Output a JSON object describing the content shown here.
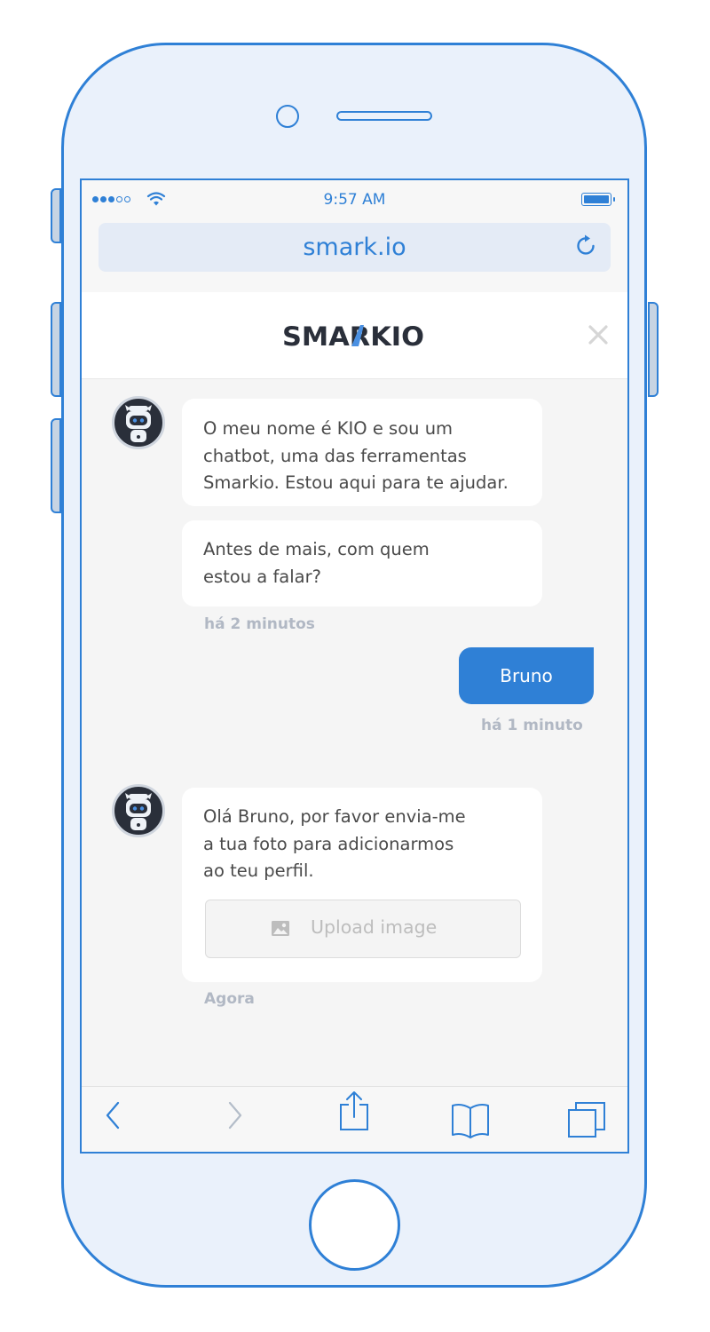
{
  "status_bar": {
    "time": "9:57 AM"
  },
  "browser": {
    "url": "smark.io"
  },
  "header": {
    "logo_text": "SMARKIO"
  },
  "messages": [
    {
      "from": "bot",
      "lines": [
        "O meu nome é KIO e sou um",
        "chatbot, uma das ferramentas",
        "Smarkio. Estou aqui para te ajudar."
      ]
    },
    {
      "from": "bot",
      "lines": [
        "Antes de mais, com quem",
        "estou a falar?"
      ]
    },
    {
      "timestamp": "há 2 minutos"
    },
    {
      "from": "user",
      "text": "Bruno",
      "timestamp": "há 1 minuto"
    },
    {
      "from": "bot",
      "lines": [
        "Olá Bruno, por favor envia-me",
        "a tua foto para adicionarmos",
        "ao teu perfil."
      ],
      "upload_label": "Upload image",
      "timestamp": "Agora"
    }
  ],
  "toolbar": {
    "icons": [
      "back-icon",
      "forward-icon",
      "share-icon",
      "bookmarks-icon",
      "tabs-icon"
    ]
  },
  "colors": {
    "accent": "#2f80d6",
    "background": "#f5f5f5",
    "logo_dark": "#2a2f3a"
  }
}
